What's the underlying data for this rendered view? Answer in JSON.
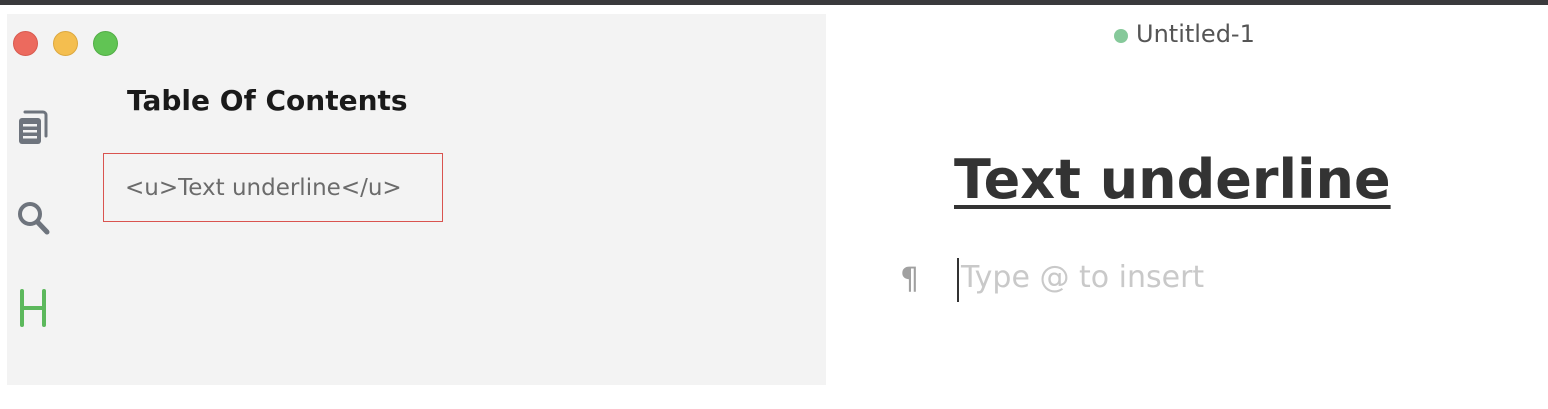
{
  "window": {
    "traffic_lights": [
      "close",
      "minimize",
      "zoom"
    ]
  },
  "sidebar": {
    "rail": [
      {
        "icon": "files-icon"
      },
      {
        "icon": "search-icon"
      },
      {
        "icon": "heading-icon",
        "active_color": "#5cb85c"
      }
    ],
    "toc": {
      "title": "Table Of Contents",
      "items": [
        {
          "label": "<u>Text underline</u>"
        }
      ]
    }
  },
  "document": {
    "title": "Untitled-1",
    "status_color": "#86c99a",
    "heading": "Text underline",
    "paragraph_placeholder": "Type @ to insert"
  }
}
